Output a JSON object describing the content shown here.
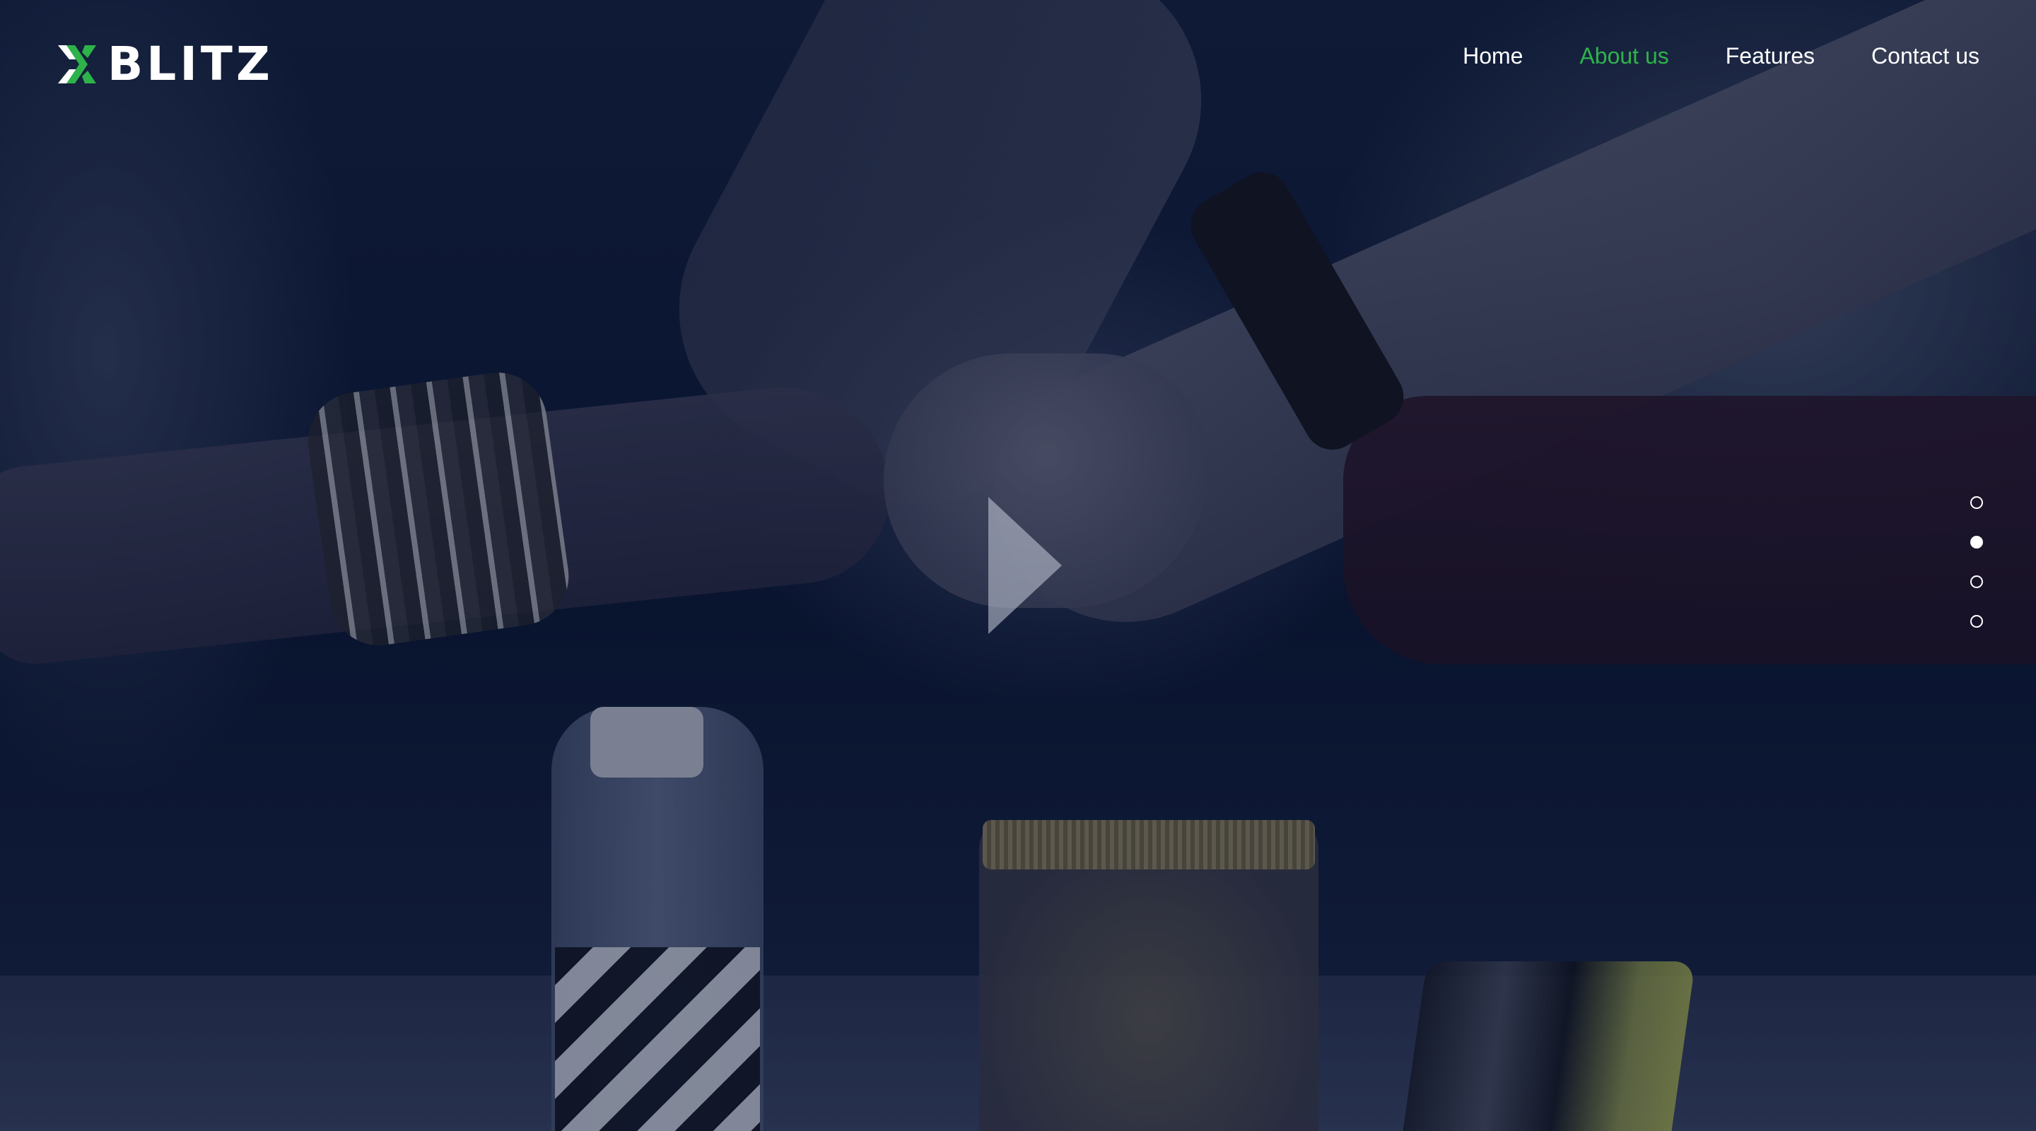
{
  "brand": {
    "name": "BLITZ",
    "accent_color": "#2eb34a",
    "logo_icon": "x-chevron-logo-icon"
  },
  "nav": {
    "items": [
      {
        "label": "Home",
        "active": false
      },
      {
        "label": "About us",
        "active": true
      },
      {
        "label": "Features",
        "active": false
      },
      {
        "label": "Contact us",
        "active": false
      }
    ]
  },
  "hero": {
    "background": "team fist-bump photo with dark blue overlay",
    "play_button_icon": "play-icon"
  },
  "slider": {
    "dot_count": 4,
    "active_index": 1
  }
}
